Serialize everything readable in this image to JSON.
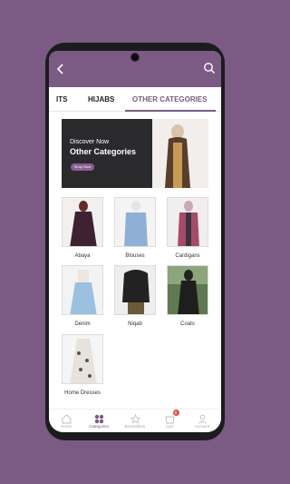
{
  "tabs": [
    "ITS",
    "HIJABS",
    "OTHER CATEGORIES"
  ],
  "banner": {
    "line1": "Discover Now",
    "line2": "Other Categories",
    "button": "Shop Now"
  },
  "categories": [
    "Abaya",
    "Blouses",
    "Cardigans",
    "Denim",
    "Niqab",
    "Coats",
    "Home Dresses"
  ],
  "bottom_nav": {
    "home": "Home",
    "categories": "Categories",
    "bestsellers": "BestSellers",
    "cart": "Cart",
    "cart_count": "0",
    "account": "Account"
  },
  "colors": {
    "brand": "#7b5a84",
    "badge": "#d9534f"
  }
}
